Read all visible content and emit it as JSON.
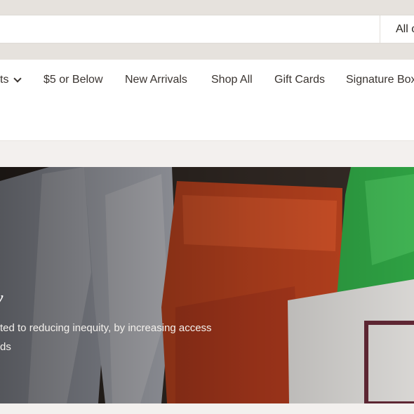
{
  "search": {
    "scope_label": "All c"
  },
  "nav": {
    "items": [
      {
        "label": "ts",
        "has_dropdown": true
      },
      {
        "label": "$5 or Below"
      },
      {
        "label": "New Arrivals"
      },
      {
        "label": "Shop All"
      },
      {
        "label": "Gift Cards"
      },
      {
        "label": "Signature Box"
      }
    ]
  },
  "hero": {
    "heading_fragment": "y",
    "line1": "ted to reducing inequity, by increasing access",
    "line2": "ds"
  },
  "colors": {
    "header_band": "#e6e2dd",
    "page_bg": "#f3f0ee",
    "nav_bg": "#ffffff",
    "text": "#2a2622"
  }
}
